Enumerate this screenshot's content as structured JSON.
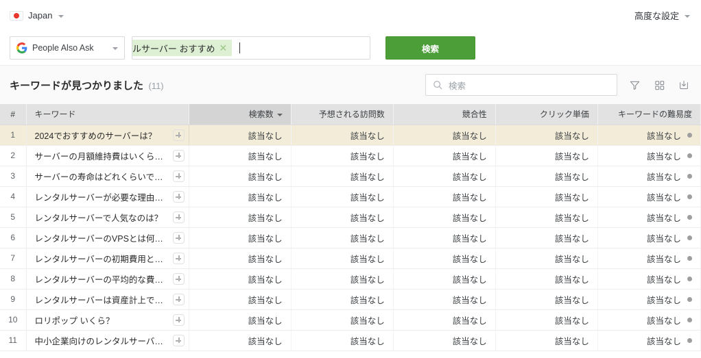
{
  "topbar": {
    "country": "Japan",
    "country_flag_icon": "japan-flag-icon",
    "advanced_settings": "高度な設定"
  },
  "search": {
    "engine": "People Also Ask",
    "engine_icon": "google-logo-icon",
    "chip_text": "ルサーバー おすすめ",
    "chip_remove_icon": "close-icon",
    "query_placeholder": "",
    "search_button": "検索"
  },
  "results": {
    "title": "キーワードが見つかりました",
    "count": "(11)",
    "table_search_placeholder": "検索",
    "search_icon": "search-icon",
    "filter_icon": "filter-icon",
    "columns_icon": "grid-columns-icon",
    "export_icon": "export-download-icon"
  },
  "table": {
    "columns": [
      {
        "label": "#",
        "align": "center"
      },
      {
        "label": "キーワード",
        "align": "left"
      },
      {
        "label": "検索数",
        "align": "right",
        "sorted": true
      },
      {
        "label": "予想される訪問数",
        "align": "right"
      },
      {
        "label": "競合性",
        "align": "right"
      },
      {
        "label": "クリック単価",
        "align": "right"
      },
      {
        "label": "キーワードの難易度",
        "align": "right"
      }
    ],
    "na_label": "該当なし",
    "rows": [
      {
        "num": "1",
        "keyword": "2024でおすすめのサーバーは？",
        "volume": "該当なし",
        "visits": "該当なし",
        "competition": "該当なし",
        "cpc": "該当なし",
        "difficulty": "該当なし",
        "highlighted": true
      },
      {
        "num": "2",
        "keyword": "サーバーの月額維持費はいくら…",
        "volume": "該当なし",
        "visits": "該当なし",
        "competition": "該当なし",
        "cpc": "該当なし",
        "difficulty": "該当なし",
        "highlighted": false
      },
      {
        "num": "3",
        "keyword": "サーバーの寿命はどれくらいで…",
        "volume": "該当なし",
        "visits": "該当なし",
        "competition": "該当なし",
        "cpc": "該当なし",
        "difficulty": "該当なし",
        "highlighted": false
      },
      {
        "num": "4",
        "keyword": "レンタルサーバーが必要な理由…",
        "volume": "該当なし",
        "visits": "該当なし",
        "competition": "該当なし",
        "cpc": "該当なし",
        "difficulty": "該当なし",
        "highlighted": false
      },
      {
        "num": "5",
        "keyword": "レンタルサーバーで人気なのは？",
        "volume": "該当なし",
        "visits": "該当なし",
        "competition": "該当なし",
        "cpc": "該当なし",
        "difficulty": "該当なし",
        "highlighted": false
      },
      {
        "num": "6",
        "keyword": "レンタルサーバーのVPSとは何…",
        "volume": "該当なし",
        "visits": "該当なし",
        "competition": "該当なし",
        "cpc": "該当なし",
        "difficulty": "該当なし",
        "highlighted": false
      },
      {
        "num": "7",
        "keyword": "レンタルサーバーの初期費用と…",
        "volume": "該当なし",
        "visits": "該当なし",
        "competition": "該当なし",
        "cpc": "該当なし",
        "difficulty": "該当なし",
        "highlighted": false
      },
      {
        "num": "8",
        "keyword": "レンタルサーバーの平均的な費…",
        "volume": "該当なし",
        "visits": "該当なし",
        "competition": "該当なし",
        "cpc": "該当なし",
        "difficulty": "該当なし",
        "highlighted": false
      },
      {
        "num": "9",
        "keyword": "レンタルサーバーは資産計上で…",
        "volume": "該当なし",
        "visits": "該当なし",
        "competition": "該当なし",
        "cpc": "該当なし",
        "difficulty": "該当なし",
        "highlighted": false
      },
      {
        "num": "10",
        "keyword": "ロリポップ いくら？",
        "volume": "該当なし",
        "visits": "該当なし",
        "competition": "該当なし",
        "cpc": "該当なし",
        "difficulty": "該当なし",
        "highlighted": false
      },
      {
        "num": "11",
        "keyword": "中小企業向けのレンタルサーバ…",
        "volume": "該当なし",
        "visits": "該当なし",
        "competition": "該当なし",
        "cpc": "該当なし",
        "difficulty": "該当なし",
        "highlighted": false
      }
    ]
  },
  "colors": {
    "accent_green": "#4c9f38",
    "chip_green": "#ddf0d4",
    "row_highlight": "#f2ecd8",
    "header_gray": "#e2e2e2",
    "sorted_header_gray": "#d4d4d4",
    "muted_text": "#a6a6a6",
    "dot_gray": "#9e9e9e"
  }
}
